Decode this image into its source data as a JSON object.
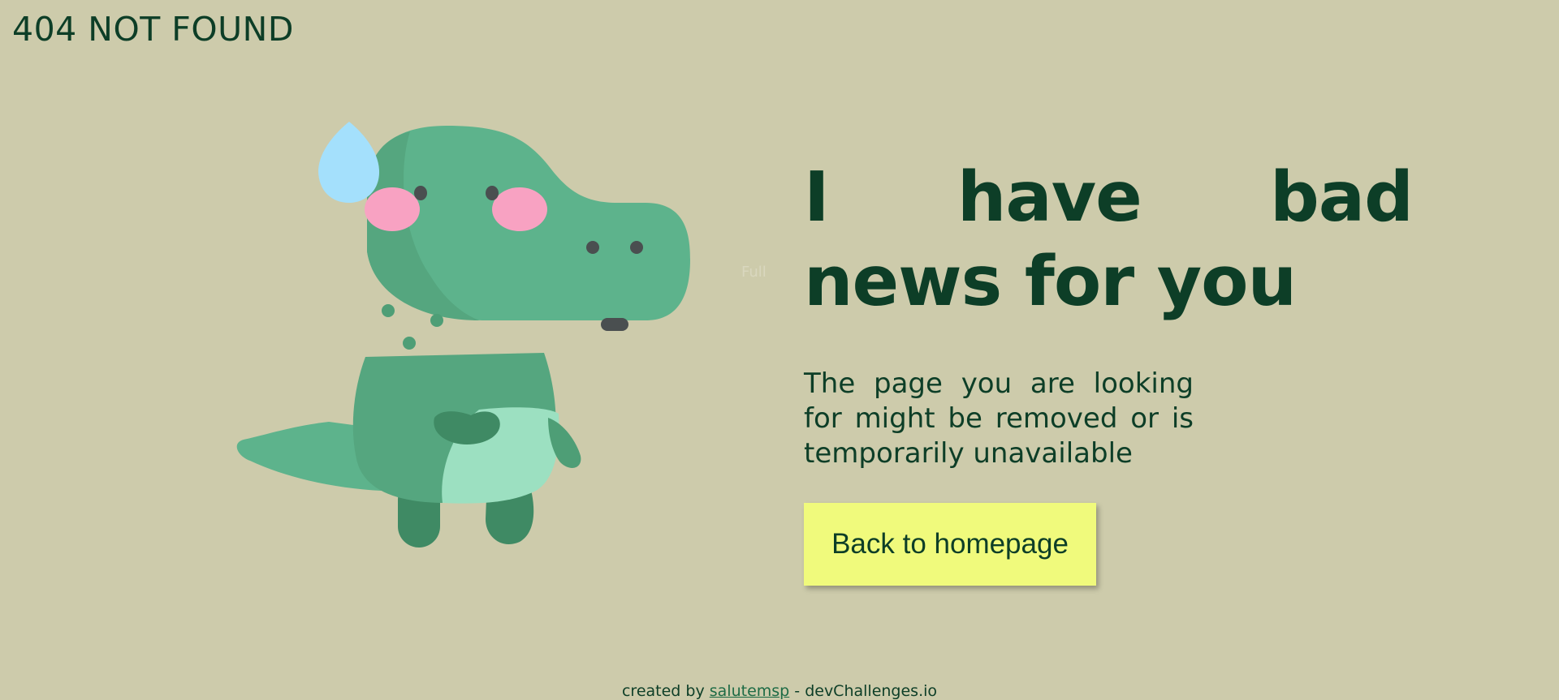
{
  "header": {
    "title": "404 NOT FOUND"
  },
  "illustration": {
    "icon": "dinosaur-illustration",
    "alt_text": "Full"
  },
  "main": {
    "headline": "I have bad news for you",
    "message": "The page you are looking for might be removed or is temporarily unavailable",
    "button_label": "Back to homepage"
  },
  "footer": {
    "prefix": "created by",
    "author": "salutemsp",
    "separator": "-",
    "site": "devChallenges.io"
  },
  "colors": {
    "background": "#cdcbab",
    "text": "#0d3e27",
    "button": "#f0fa7c",
    "dino_body": "#5db38c",
    "cheek": "#f8a2c2",
    "drop": "#a4e0fc"
  }
}
